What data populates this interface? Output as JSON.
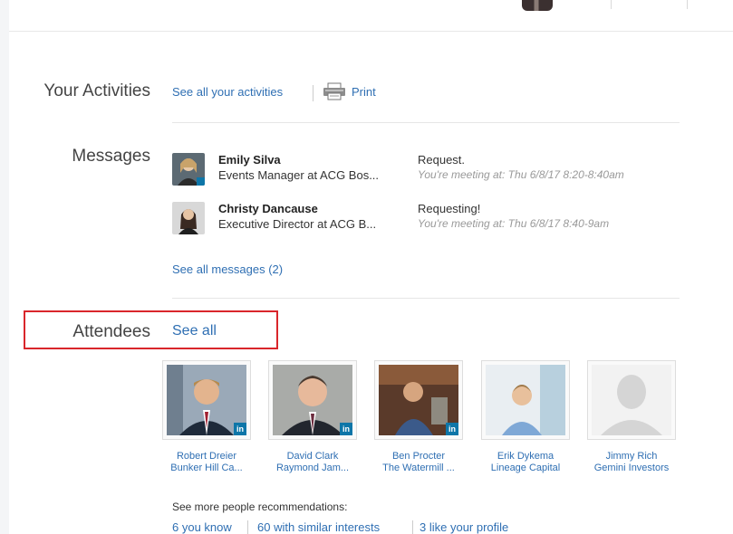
{
  "activities": {
    "label": "Your Activities",
    "see_all": "See all your activities",
    "print": "Print"
  },
  "messages": {
    "label": "Messages",
    "items": [
      {
        "name": "Emily Silva",
        "title": "Events Manager at ACG Bos...",
        "subject": "Request.",
        "meeting": "You're meeting at: Thu 6/8/17 8:20-8:40am"
      },
      {
        "name": "Christy Dancause",
        "title": "Executive Director at ACG B...",
        "subject": "Requesting!",
        "meeting": "You're meeting at: Thu 6/8/17 8:40-9am"
      }
    ],
    "see_all": "See all messages (2)"
  },
  "attendees": {
    "label": "Attendees",
    "see_all": "See all",
    "people": [
      {
        "name": "Robert Dreier",
        "company": "Bunker Hill Ca...",
        "linkedin": "in"
      },
      {
        "name": "David Clark",
        "company": "Raymond Jam...",
        "linkedin": "in"
      },
      {
        "name": "Ben Procter",
        "company": "The Watermill ...",
        "linkedin": "in"
      },
      {
        "name": "Erik Dykema",
        "company": "Lineage Capital",
        "linkedin": ""
      },
      {
        "name": "Jimmy Rich",
        "company": "Gemini Investors",
        "linkedin": ""
      }
    ]
  },
  "recommendations": {
    "title": "See more people recommendations:",
    "links": [
      "6 you know",
      "60 with similar interests",
      "3 like your profile"
    ]
  },
  "colors": {
    "link": "#2f6fb3",
    "highlight": "#d9262b",
    "linkedin": "#0e76a8"
  },
  "icons": [
    "printer-icon",
    "linkedin-badge-icon",
    "default-avatar-icon"
  ]
}
